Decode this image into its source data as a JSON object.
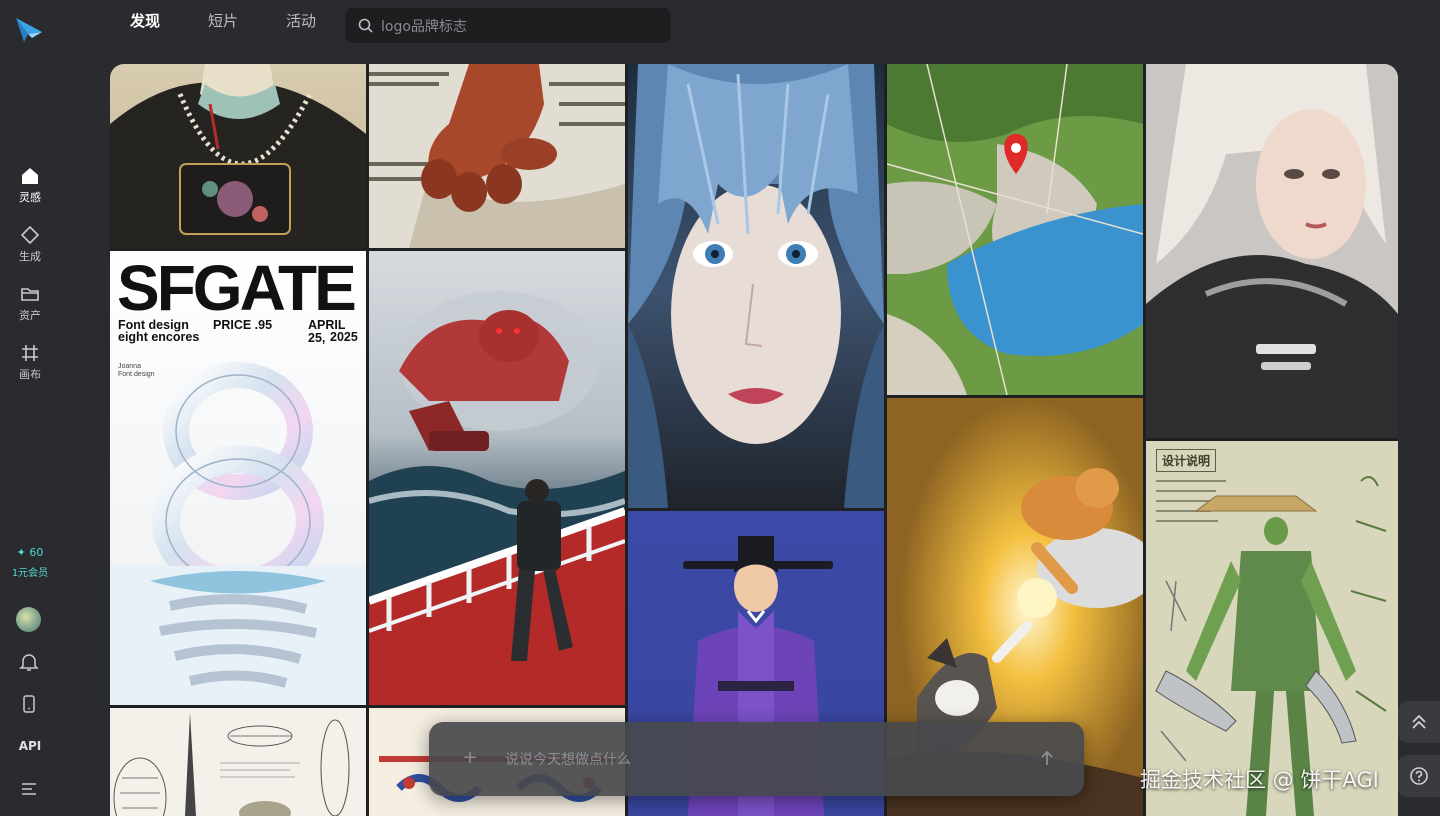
{
  "app": {
    "brand_color": "#3aa6e8",
    "accent_color": "#56d6d0"
  },
  "sidebar": {
    "items": [
      {
        "label": "灵感",
        "icon": "home-icon",
        "active": true
      },
      {
        "label": "生成",
        "icon": "diamond-icon",
        "active": false
      },
      {
        "label": "资产",
        "icon": "folder-icon",
        "active": false
      },
      {
        "label": "画布",
        "icon": "canvas-grid-icon",
        "active": false
      }
    ],
    "credits": "✦ 60",
    "membership": "1元会员",
    "api_label": "API"
  },
  "topnav": {
    "tabs": [
      {
        "label": "发现",
        "active": true
      },
      {
        "label": "短片",
        "active": false
      },
      {
        "label": "活动",
        "active": false
      }
    ],
    "search_placeholder": "logo品牌标志"
  },
  "gallery": {
    "poster": {
      "title": "SFGATE",
      "left_line1": "Font design",
      "left_line2": "eight encores",
      "price": "PRICE .95",
      "date_line1": "APRIL 25,",
      "date_line2": "2025",
      "credit_line1": "Joanna",
      "credit_line2": "Font design"
    },
    "design_sheet_label": "设计说明"
  },
  "composer": {
    "placeholder": "说说今天想做点什么",
    "plus": "+"
  },
  "watermark": "掘金技术社区 @ 饼干AGI"
}
